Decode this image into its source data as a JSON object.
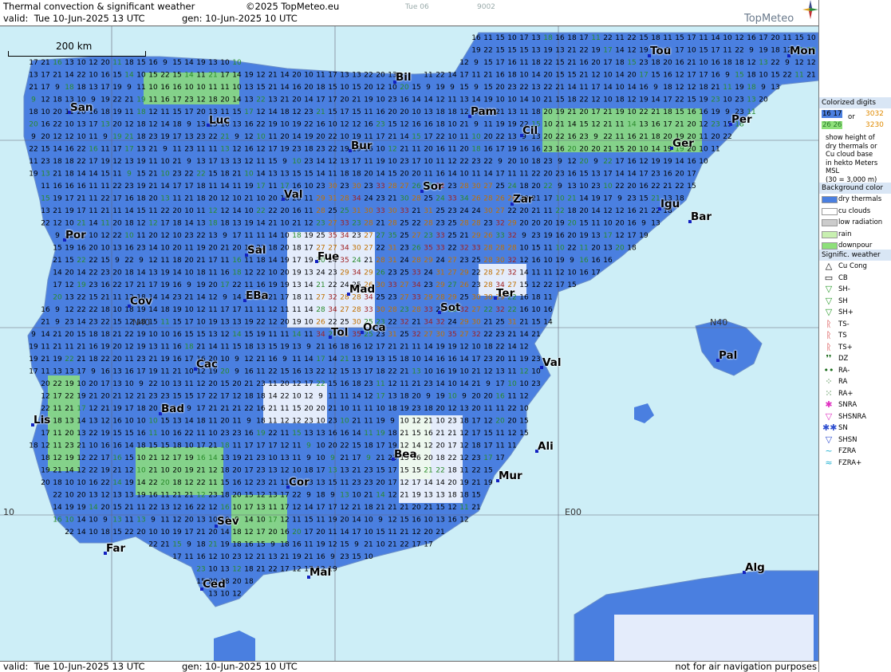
{
  "header": {
    "title": "Thermal convection & significant weather",
    "copyright": "©2025 TopMeteo.eu",
    "valid_label": "valid:",
    "valid_time": "Tue  10-Jun-2025  13 UTC",
    "gen_label": "gen:",
    "gen_time": "10-Jun-2025 10 UTC",
    "faint_day": "Tue 06",
    "faint_code": "9002",
    "logo_text": "TopMeteo"
  },
  "footer": {
    "valid_label": "valid:",
    "valid_time": "Tue  10-Jun-2025  13 UTC",
    "gen_label": "gen:",
    "gen_time": "10-Jun-2025 10 UTC",
    "disclaimer": "not for air navigation purposes"
  },
  "map": {
    "scale_label": "200 km",
    "grid_labels": [
      "N40",
      "E00",
      "10",
      "N40"
    ],
    "cities": [
      {
        "name": "San"
      },
      {
        "name": "Luc"
      },
      {
        "name": "Bil"
      },
      {
        "name": "Pam"
      },
      {
        "name": "Tou"
      },
      {
        "name": "Mon"
      },
      {
        "name": "Per"
      },
      {
        "name": "Cil"
      },
      {
        "name": "Ger"
      },
      {
        "name": "Bur"
      },
      {
        "name": "Val"
      },
      {
        "name": "Sor"
      },
      {
        "name": "Zar"
      },
      {
        "name": "Igu"
      },
      {
        "name": "Bar"
      },
      {
        "name": "Por"
      },
      {
        "name": "Sal"
      },
      {
        "name": "Fue"
      },
      {
        "name": "Mad"
      },
      {
        "name": "Cov"
      },
      {
        "name": "EBa"
      },
      {
        "name": "Tol"
      },
      {
        "name": "Oca"
      },
      {
        "name": "Sot"
      },
      {
        "name": "Ter"
      },
      {
        "name": "Pal"
      },
      {
        "name": "Val"
      },
      {
        "name": "Cac"
      },
      {
        "name": "Bad"
      },
      {
        "name": "Lis"
      },
      {
        "name": "Ali"
      },
      {
        "name": "Bea"
      },
      {
        "name": "Mur"
      },
      {
        "name": "Cor"
      },
      {
        "name": "Sev"
      },
      {
        "name": "Far"
      },
      {
        "name": "Mal"
      },
      {
        "name": "Ced"
      },
      {
        "name": "Alg"
      }
    ]
  },
  "legend": {
    "colorized_title": "Colorized digits",
    "digit_a": "16  17",
    "digit_or": "or",
    "digit_b": "3032",
    "digit_c": "26 26",
    "digit_d": "3230",
    "note_lines": [
      "show height of",
      "dry thermals or",
      "Cu cloud base",
      "in hekto Meters",
      "MSL",
      "(30 = 3,000 m)"
    ],
    "background_title": "Background color",
    "backgrounds": [
      {
        "label": "dry thermals",
        "color": "#4a7fe0"
      },
      {
        "label": "cu clouds",
        "color": "#ffffff"
      },
      {
        "label": "low radiation",
        "color": "#cccccc"
      },
      {
        "label": "rain",
        "color": "#c8f0b0"
      },
      {
        "label": "downpour",
        "color": "#8ee07a"
      }
    ],
    "weather_title": "Signific. weather",
    "weather": [
      {
        "label": "Cu Cong",
        "icon": "cu-cong-icon"
      },
      {
        "label": "CB",
        "icon": "cb-icon"
      },
      {
        "label": "SH-",
        "icon": "shower-light-icon"
      },
      {
        "label": "SH",
        "icon": "shower-icon"
      },
      {
        "label": "SH+",
        "icon": "shower-heavy-icon"
      },
      {
        "label": "TS-",
        "icon": "thunderstorm-light-icon"
      },
      {
        "label": "TS",
        "icon": "thunderstorm-icon"
      },
      {
        "label": "TS+",
        "icon": "thunderstorm-heavy-icon"
      },
      {
        "label": "DZ",
        "icon": "drizzle-icon"
      },
      {
        "label": "RA-",
        "icon": "rain-light-icon"
      },
      {
        "label": "RA",
        "icon": "rain-icon"
      },
      {
        "label": "RA+",
        "icon": "rain-heavy-icon"
      },
      {
        "label": "SNRA",
        "icon": "snow-rain-icon"
      },
      {
        "label": "SHSNRA",
        "icon": "snow-rain-shower-icon"
      },
      {
        "label": "SN",
        "icon": "snow-icon"
      },
      {
        "label": "SHSN",
        "icon": "snow-shower-icon"
      },
      {
        "label": "FZRA",
        "icon": "freezing-rain-icon"
      },
      {
        "label": "FZRA+",
        "icon": "freezing-rain-heavy-icon"
      }
    ]
  }
}
